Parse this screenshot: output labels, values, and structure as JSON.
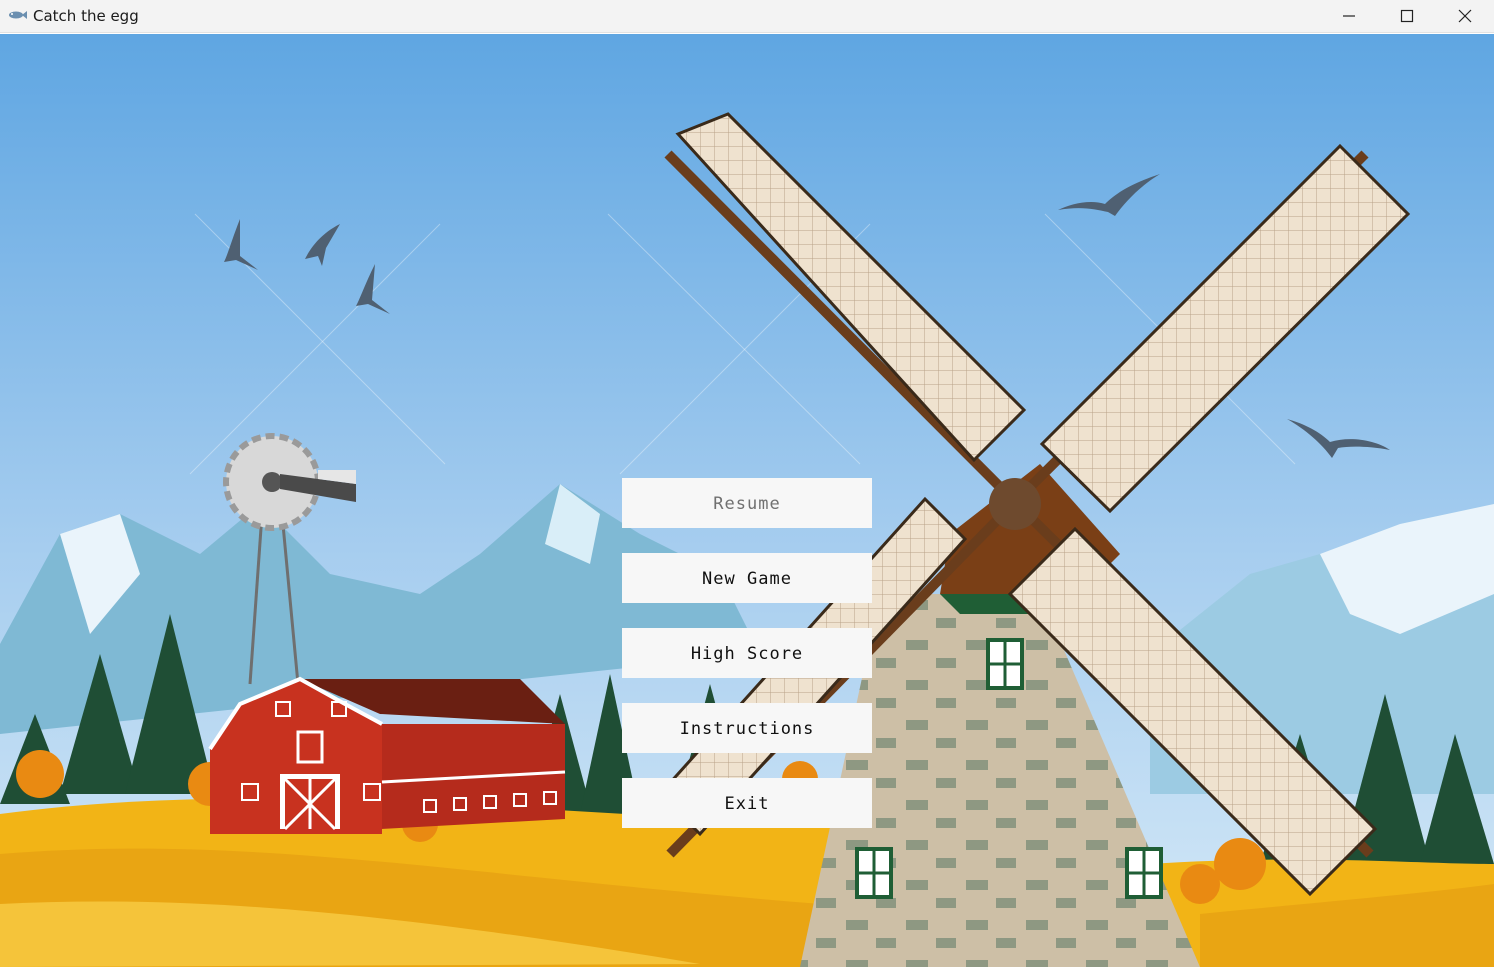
{
  "window": {
    "title": "Catch the egg",
    "app_icon": "fish-icon",
    "controls": [
      "minimize-icon",
      "maximize-icon",
      "close-icon"
    ]
  },
  "menu": {
    "resume_label": "Resume",
    "new_game_label": "New Game",
    "high_score_label": "High Score",
    "instructions_label": "Instructions",
    "exit_label": "Exit"
  },
  "colors": {
    "sky_top": "#5fa6e2",
    "sky_bottom": "#cfe6f7",
    "barn_red": "#c8321f",
    "field_yellow": "#f2b416",
    "button_bg": "#f7f7f7"
  }
}
